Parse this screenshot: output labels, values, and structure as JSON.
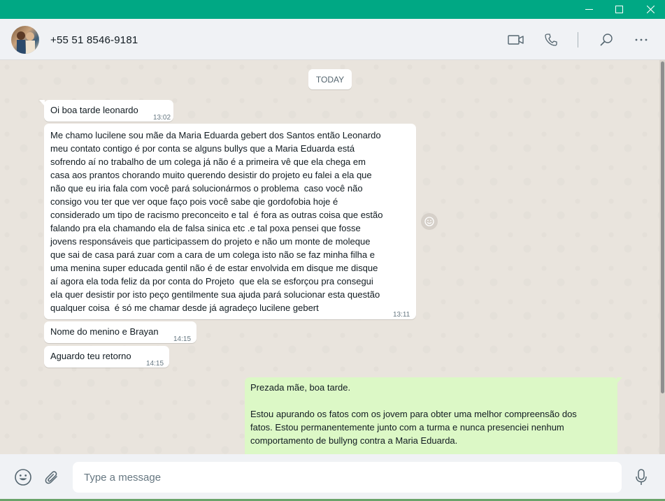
{
  "window": {
    "controls": [
      "minimize",
      "maximize",
      "close"
    ]
  },
  "header": {
    "contact_name": "+55 51 8546-9181",
    "icons": [
      "video-call-icon",
      "voice-call-icon",
      "search-icon",
      "more-options-icon"
    ]
  },
  "chat": {
    "day_label": "TODAY",
    "messages": [
      {
        "direction": "in",
        "text": "Oi boa tarde leonardo",
        "time": "13:02"
      },
      {
        "direction": "in",
        "text": "Me chamo lucilene sou mãe da Maria Eduarda gebert dos Santos então Leonardo\nmeu contato contigo é por conta se alguns bullys que a Maria Eduarda está\nsofrendo aí no trabalho de um colega já não é a primeira vê que ela chega em\ncasa aos prantos chorando muito querendo desistir do projeto eu falei a ela que\nnão que eu iria fala com você pará solucionármos o problema  caso você não\nconsigo vou ter que ver oque faço pois você sabe qie gordofobia hoje é\nconsiderado um tipo de racismo preconceito e tal  é fora as outras coisa que estão\nfalando pra ela chamando ela de falsa sinica etc .e tal poxa pensei que fosse\njovens responsáveis que participassem do projeto e não um monte de moleque\nque sai de casa pará zuar com a cara de um colega isto não se faz minha filha e\numa menina super educada gentil não é de estar envolvida em disque me disque\naí agora ela toda feliz da por conta do Projeto  que ela se esforçou pra consegui\nela quer desistir por isto peço gentilmente sua ajuda pará solucionar esta questão\nqualquer coisa  é só me chamar desde já agradeço lucilene gebert",
        "time": "13:11"
      },
      {
        "direction": "in",
        "text": "Nome do menino e Brayan",
        "time": "14:15"
      },
      {
        "direction": "in",
        "text": "Aguardo teu retorno",
        "time": "14:15"
      },
      {
        "direction": "out",
        "text": "Prezada mãe, boa tarde.\n\nEstou apurando os fatos com os jovem para obter uma melhor compreensão dos\nfatos. Estou permanentemente junto com a turma e nunca presenciei nenhum\ncomportamento de bullyng contra a Maria Eduarda.",
        "time": ""
      }
    ],
    "reaction_icon": "emoji-reaction-icon"
  },
  "footer": {
    "placeholder": "Type a message",
    "value": "",
    "icons": [
      "emoji-icon",
      "attach-icon",
      "microphone-icon"
    ]
  },
  "colors": {
    "titlebar": "#00a884",
    "header_bg": "#f0f2f5",
    "chat_bg": "#e9e4dd",
    "incoming_bubble": "#ffffff",
    "outgoing_bubble": "#dcf8c6",
    "icon": "#54656f"
  }
}
